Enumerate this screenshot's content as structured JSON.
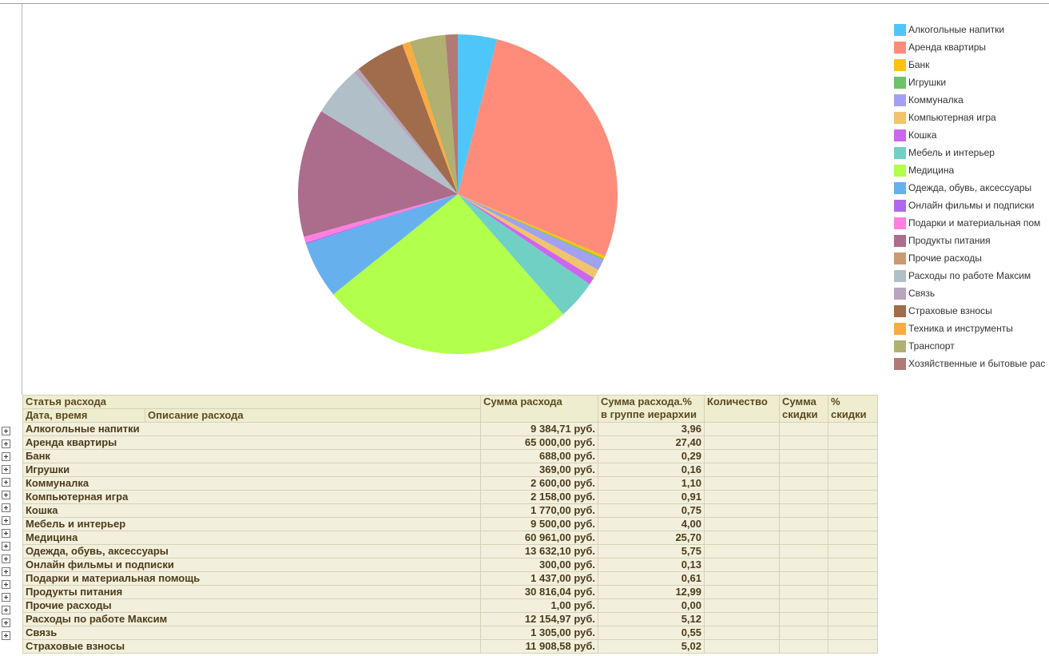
{
  "chart_data": {
    "type": "pie",
    "title": "",
    "legend_position": "right",
    "categories": [
      "Алкогольные напитки",
      "Аренда квартиры",
      "Банк",
      "Игрушки",
      "Коммуналка",
      "Компьютерная игра",
      "Кошка",
      "Мебель и интерьер",
      "Медицина",
      "Одежда, обувь, аксессуары",
      "Онлайн фильмы и подписки",
      "Подарки и материальная помощь",
      "Продукты питания",
      "Прочие расходы",
      "Расходы по работе Максим",
      "Связь",
      "Страховые взносы",
      "Техника и инструменты",
      "Транспорт",
      "Хозяйственные и бытовые расходы"
    ],
    "values": [
      3.96,
      27.4,
      0.29,
      0.16,
      1.1,
      0.91,
      0.75,
      4.0,
      25.7,
      5.75,
      0.13,
      0.61,
      12.99,
      0.0,
      5.12,
      0.55,
      5.02,
      0.8,
      3.6,
      1.25
    ],
    "colors": [
      "#4FC6FA",
      "#FF8C7A",
      "#FFC20E",
      "#6CC26C",
      "#A2A0F0",
      "#EFC46C",
      "#CC66EE",
      "#70D0C4",
      "#B2FF4C",
      "#66B0EE",
      "#AE6AEC",
      "#FF80DE",
      "#AC6C8C",
      "#C89B72",
      "#B0BFC8",
      "#B8A4BC",
      "#A06C4C",
      "#F8AC40",
      "#B0B070",
      "#B07A76"
    ]
  },
  "legend_labels": {
    "l0": "Алкогольные напитки",
    "l1": "Аренда квартиры",
    "l2": "Банк",
    "l3": "Игрушки",
    "l4": "Коммуналка",
    "l5": "Компьютерная игра",
    "l6": "Кошка",
    "l7": "Мебель и интерьер",
    "l8": "Медицина",
    "l9": "Одежда, обувь, аксессуары",
    "l10": "Онлайн фильмы и подписки",
    "l11": "Подарки и материальная пом",
    "l12": "Продукты питания",
    "l13": "Прочие расходы",
    "l14": "Расходы по работе Максим",
    "l15": "Связь",
    "l16": "Страховые взносы",
    "l17": "Техника и инструменты",
    "l18": "Транспорт",
    "l19": "Хозяйственные и бытовые рас"
  },
  "table": {
    "headers": {
      "article": "Статья расхода",
      "datetime": "Дата, время",
      "description": "Описание расхода",
      "sum": "Сумма расхода",
      "pct_line1": "Сумма расхода.%",
      "pct_line2": "в группе иерархии",
      "qty": "Количество",
      "disc_sum_line1": "Сумма",
      "disc_sum_line2": "скидки",
      "disc_pct_line1": "%",
      "disc_pct_line2": "скидки"
    },
    "rows": [
      {
        "name": "Алкогольные напитки",
        "sum": "9 384,71 руб.",
        "pct": "3,96"
      },
      {
        "name": "Аренда квартиры",
        "sum": "65 000,00 руб.",
        "pct": "27,40"
      },
      {
        "name": "Банк",
        "sum": "688,00 руб.",
        "pct": "0,29"
      },
      {
        "name": "Игрушки",
        "sum": "369,00 руб.",
        "pct": "0,16"
      },
      {
        "name": "Коммуналка",
        "sum": "2 600,00 руб.",
        "pct": "1,10"
      },
      {
        "name": "Компьютерная игра",
        "sum": "2 158,00 руб.",
        "pct": "0,91"
      },
      {
        "name": "Кошка",
        "sum": "1 770,00 руб.",
        "pct": "0,75"
      },
      {
        "name": "Мебель и интерьер",
        "sum": "9 500,00 руб.",
        "pct": "4,00"
      },
      {
        "name": "Медицина",
        "sum": "60 961,00 руб.",
        "pct": "25,70"
      },
      {
        "name": "Одежда, обувь, аксессуары",
        "sum": "13 632,10 руб.",
        "pct": "5,75"
      },
      {
        "name": "Онлайн фильмы и подписки",
        "sum": "300,00 руб.",
        "pct": "0,13"
      },
      {
        "name": "Подарки и материальная помощь",
        "sum": "1 437,00 руб.",
        "pct": "0,61"
      },
      {
        "name": "Продукты питания",
        "sum": "30 816,04 руб.",
        "pct": "12,99"
      },
      {
        "name": "Прочие расходы",
        "sum": "1,00 руб.",
        "pct": "0,00"
      },
      {
        "name": "Расходы по работе Максим",
        "sum": "12 154,97 руб.",
        "pct": "5,12"
      },
      {
        "name": "Связь",
        "sum": "1 305,00 руб.",
        "pct": "0,55"
      },
      {
        "name": "Страховые взносы",
        "sum": "11 908,58 руб.",
        "pct": "5,02"
      }
    ]
  }
}
